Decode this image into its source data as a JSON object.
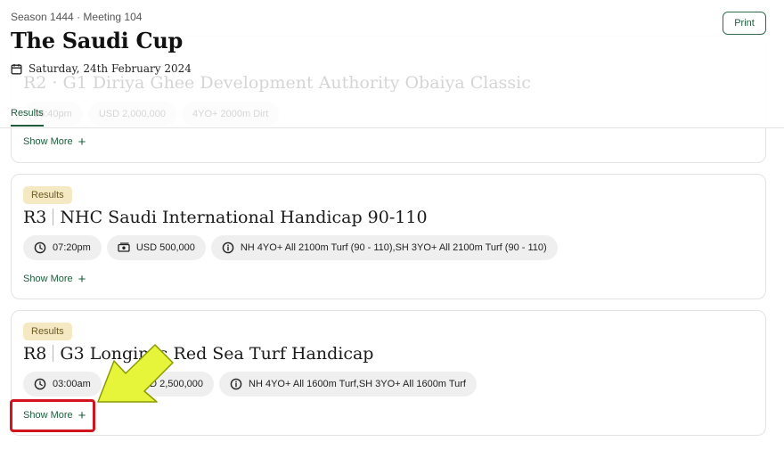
{
  "header": {
    "season": "Season 1444 · Meeting 104",
    "title": "The Saudi Cup",
    "date": "Saturday, 24th February 2024",
    "print_label": "Print",
    "tab_results": "Results",
    "calendar_icon": "calendar-icon"
  },
  "race1_partial": {
    "title": "R2 · G1 Diriya Ghee Development Authority Obaiya Classic",
    "time": "06:40pm",
    "prize": "USD 2,000,000",
    "info": "4YO+ 2000m Dirt",
    "show_more": "Show More"
  },
  "race2": {
    "badge": "Results",
    "number": "R3",
    "name": "NHC Saudi International Handicap 90-110",
    "time": "07:20pm",
    "prize": "USD 500,000",
    "info": "NH 4YO+ All 2100m Turf (90 - 110),SH 3YO+ All 2100m Turf (90 - 110)",
    "show_more": "Show More"
  },
  "race3": {
    "badge": "Results",
    "number": "R8",
    "name": "G3 Longines Red Sea Turf Handicap",
    "time": "03:00am",
    "prize": "USD 2,500,000",
    "info": "NH 4YO+ All 1600m Turf,SH 3YO+ All 1600m Turf",
    "show_more": "Show More"
  },
  "icons": {
    "time": "clock-icon",
    "prize": "money-icon",
    "info": "info-icon",
    "expand": "plus-icon"
  },
  "colors": {
    "brand_green": "#1e5c3c",
    "badge_bg": "#f5e9c4",
    "chip_bg": "#efefef",
    "annotation_red": "#d3141e",
    "annotation_arrow": "#e6f53a"
  }
}
